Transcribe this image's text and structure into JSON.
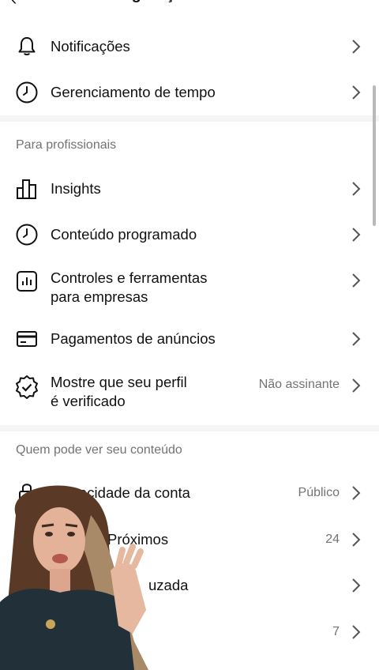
{
  "header": {
    "title": "Configurações e atividade"
  },
  "items_top": [
    {
      "label": "Notificações",
      "icon": "bell-icon"
    },
    {
      "label": "Gerenciamento de tempo",
      "icon": "clock-icon"
    }
  ],
  "section_pro": {
    "title": "Para profissionais",
    "items": [
      {
        "label": "Insights",
        "icon": "bar-chart-icon"
      },
      {
        "label": "Conteúdo programado",
        "icon": "clock-icon"
      },
      {
        "label_line1": "Controles e ferramentas",
        "label_line2": "para empresas",
        "icon": "chart-box-icon"
      },
      {
        "label": "Pagamentos de anúncios",
        "icon": "credit-card-icon"
      },
      {
        "label_line1": "Mostre que seu perfil",
        "label_line2": "é verificado",
        "value": "Não assinante",
        "icon": "verified-badge-icon"
      }
    ]
  },
  "section_visibility": {
    "title": "Quem pode ver seu conteúdo",
    "items": [
      {
        "label": "Privacidade da conta",
        "label_visible": "acidade da conta",
        "value": "Público",
        "icon": "lock-icon"
      },
      {
        "label_visible": "Próximos",
        "value": "24",
        "icon": "close-friends-icon"
      },
      {
        "label_visible": "uzada",
        "icon": "blocked-icon"
      },
      {
        "value": "7",
        "icon": "hidden-icon"
      }
    ]
  },
  "colors": {
    "text": "#111111",
    "secondary": "#737373",
    "divider": "#f5f5f5"
  }
}
